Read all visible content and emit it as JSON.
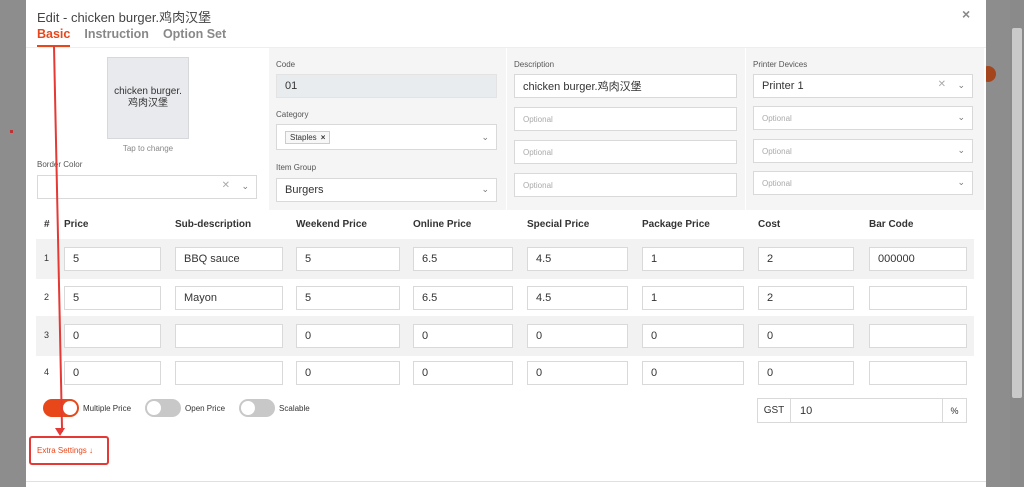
{
  "modal": {
    "title": "Edit - chicken burger.鸡肉汉堡",
    "close_icon": "×",
    "tabs": [
      {
        "label": "Basic",
        "active": true
      },
      {
        "label": "Instruction",
        "active": false
      },
      {
        "label": "Option Set",
        "active": false
      }
    ]
  },
  "item": {
    "image_text_line1": "chicken burger.",
    "image_text_line2": "鸡肉汉堡",
    "tap_hint": "Tap to change",
    "border_color_label": "Border Color",
    "code_label": "Code",
    "code_value": "01",
    "category_label": "Category",
    "category_tag": "Staples",
    "item_group_label": "Item Group",
    "item_group_value": "Burgers",
    "description_label": "Description",
    "description_value": "chicken burger.鸡肉汉堡",
    "description_placeholder": "Optional",
    "printer_label": "Printer Devices",
    "printer_value": "Printer 1",
    "printer_placeholder": "Optional"
  },
  "table": {
    "headers": [
      "#",
      "Price",
      "Sub-description",
      "Weekend Price",
      "Online Price",
      "Special Price",
      "Package Price",
      "Cost",
      "Bar Code"
    ],
    "rows": [
      {
        "num": "1",
        "price": "5",
        "sub": "BBQ sauce",
        "weekend": "5",
        "online": "6.5",
        "special": "4.5",
        "package": "1",
        "cost": "2",
        "barcode": "000000"
      },
      {
        "num": "2",
        "price": "5",
        "sub": "Mayon",
        "weekend": "5",
        "online": "6.5",
        "special": "4.5",
        "package": "1",
        "cost": "2",
        "barcode": ""
      },
      {
        "num": "3",
        "price": "0",
        "sub": "",
        "weekend": "0",
        "online": "0",
        "special": "0",
        "package": "0",
        "cost": "0",
        "barcode": ""
      },
      {
        "num": "4",
        "price": "0",
        "sub": "",
        "weekend": "0",
        "online": "0",
        "special": "0",
        "package": "0",
        "cost": "0",
        "barcode": ""
      }
    ]
  },
  "toggles": [
    {
      "label": "Multiple Price",
      "on": true
    },
    {
      "label": "Open Price",
      "on": false
    },
    {
      "label": "Scalable",
      "on": false
    }
  ],
  "gst": {
    "label": "GST",
    "value": "10",
    "unit": "%"
  },
  "extra_settings": "Extra Settings ↓",
  "colors": {
    "accent": "#e8471a",
    "annotation": "#e53935"
  }
}
